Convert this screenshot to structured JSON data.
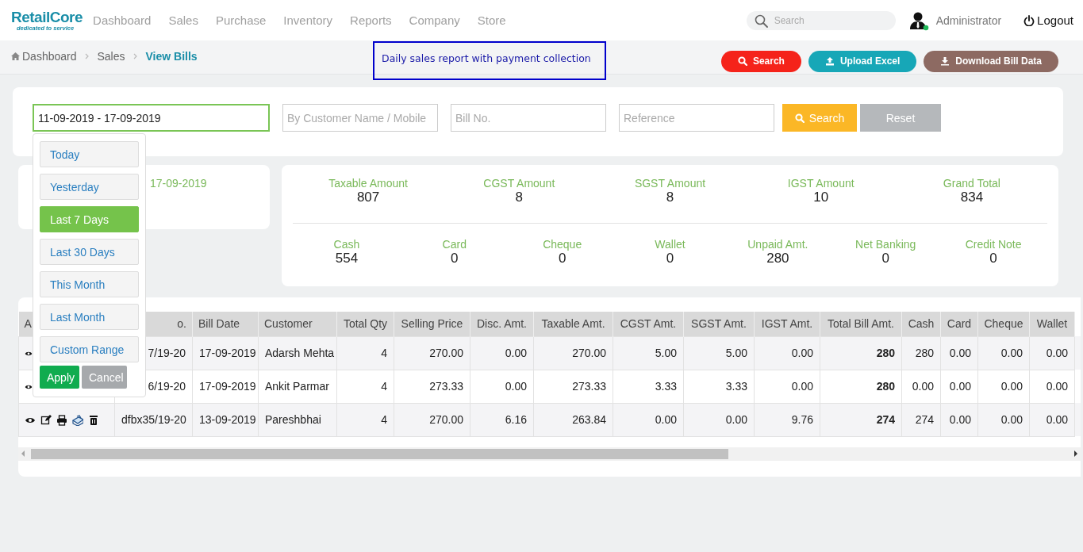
{
  "brand": {
    "name": "RetailCore",
    "tagline": "dedicated to service"
  },
  "nav": [
    {
      "label": "Dashboard",
      "selected": false
    },
    {
      "label": "Sales",
      "selected": false
    },
    {
      "label": "Purchase",
      "selected": false
    },
    {
      "label": "Inventory",
      "selected": false
    },
    {
      "label": "Reports",
      "selected": false
    },
    {
      "label": "Company",
      "selected": false
    },
    {
      "label": "Store",
      "selected": false
    }
  ],
  "search": {
    "placeholder": "Search"
  },
  "user": {
    "name": "Administrator",
    "online": true
  },
  "logout": "Logout",
  "breadcrumb": [
    {
      "label": "Dashboard",
      "current": false
    },
    {
      "label": "Sales",
      "current": false
    },
    {
      "label": "View Bills",
      "current": true
    }
  ],
  "annotation": "Daily sales report with payment collection",
  "actions": [
    {
      "label": "Search",
      "kind": "search",
      "color": "#f5231a"
    },
    {
      "label": "Upload Excel",
      "kind": "upload",
      "color": "#17a7b7"
    },
    {
      "label": "Download Bill Data",
      "kind": "download",
      "color": "#8d6a62"
    }
  ],
  "filters": {
    "date_range": "11-09-2019 - 17-09-2019",
    "customer_placeholder": "By Customer Name / Mobile",
    "bill_placeholder": "Bill No.",
    "reference_placeholder": "Reference",
    "search_button": "Search",
    "reset_button": "Reset"
  },
  "date_picker": {
    "ranges": [
      {
        "label": "Today",
        "selected": false
      },
      {
        "label": "Yesterday",
        "selected": false
      },
      {
        "label": "Last 7 Days",
        "selected": true
      },
      {
        "label": "Last 30 Days",
        "selected": false
      },
      {
        "label": "This Month",
        "selected": false
      },
      {
        "label": "Last Month",
        "selected": false
      },
      {
        "label": "Custom Range",
        "selected": false
      }
    ],
    "apply": "Apply",
    "cancel": "Cancel"
  },
  "date_card": {
    "range_end": "17-09-2019"
  },
  "summary": {
    "totals": [
      {
        "label": "Taxable Amount",
        "value": "807"
      },
      {
        "label": "CGST Amount",
        "value": "8"
      },
      {
        "label": "SGST Amount",
        "value": "8"
      },
      {
        "label": "IGST Amount",
        "value": "10"
      },
      {
        "label": "Grand Total",
        "value": "834"
      }
    ],
    "payments": [
      {
        "label": "Cash",
        "value": "554"
      },
      {
        "label": "Card",
        "value": "0"
      },
      {
        "label": "Cheque",
        "value": "0"
      },
      {
        "label": "Wallet",
        "value": "0"
      },
      {
        "label": "Unpaid Amt.",
        "value": "280"
      },
      {
        "label": "Net Banking",
        "value": "0"
      },
      {
        "label": "Credit Note",
        "value": "0"
      }
    ]
  },
  "table": {
    "columns": [
      {
        "label": "A",
        "kind": "actions"
      },
      {
        "label": "o.",
        "kind": "id"
      },
      {
        "label": "Bill Date",
        "kind": "date"
      },
      {
        "label": "Customer",
        "kind": "text"
      },
      {
        "label": "Total Qty",
        "kind": "number"
      },
      {
        "label": "Selling Price",
        "kind": "number"
      },
      {
        "label": "Disc. Amt.",
        "kind": "number"
      },
      {
        "label": "Taxable Amt.",
        "kind": "number"
      },
      {
        "label": "CGST Amt.",
        "kind": "number"
      },
      {
        "label": "SGST Amt.",
        "kind": "number"
      },
      {
        "label": "IGST Amt.",
        "kind": "number"
      },
      {
        "label": "Total Bill Amt.",
        "kind": "total"
      },
      {
        "label": "Cash",
        "kind": "number"
      },
      {
        "label": "Card",
        "kind": "number"
      },
      {
        "label": "Cheque",
        "kind": "number"
      },
      {
        "label": "Wallet",
        "kind": "number"
      }
    ],
    "rows": [
      {
        "cells": [
          "",
          "7/19-20",
          "17-09-2019",
          "Adarsh Mehta",
          "4",
          "270.00",
          "0.00",
          "270.00",
          "5.00",
          "5.00",
          "0.00",
          "280",
          "280",
          "0.00",
          "0.00",
          "0.00"
        ]
      },
      {
        "cells": [
          "",
          "6/19-20",
          "17-09-2019",
          "Ankit Parmar",
          "4",
          "273.33",
          "0.00",
          "273.33",
          "3.33",
          "3.33",
          "0.00",
          "280",
          "0.00",
          "0.00",
          "0.00",
          "0.00"
        ]
      },
      {
        "cells": [
          "",
          "dfbx35/19-20",
          "13-09-2019",
          "Pareshbhai",
          "4",
          "270.00",
          "6.16",
          "263.84",
          "0.00",
          "0.00",
          "9.76",
          "274",
          "274",
          "0.00",
          "0.00",
          "0.00"
        ]
      }
    ]
  }
}
